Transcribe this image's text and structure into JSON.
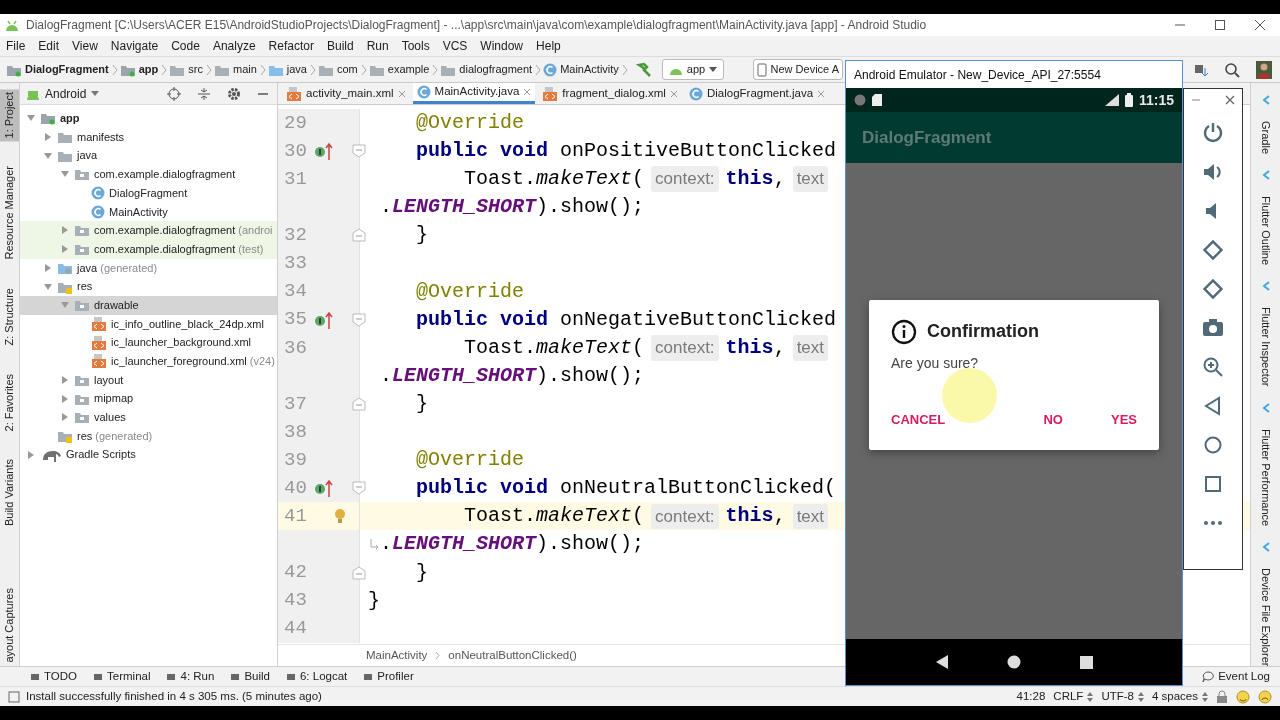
{
  "window": {
    "title": "DialogFragment [C:\\Users\\ACER E15\\AndroidStudioProjects\\DialogFragment] - ...\\app\\src\\main\\java\\com\\example\\dialogfragment\\MainActivity.java [app] - Android Studio"
  },
  "menu": [
    "File",
    "Edit",
    "View",
    "Navigate",
    "Code",
    "Analyze",
    "Refactor",
    "Build",
    "Run",
    "Tools",
    "VCS",
    "Window",
    "Help"
  ],
  "breadcrumb": [
    {
      "label": "DialogFragment",
      "kind": "project"
    },
    {
      "label": "app",
      "kind": "module"
    },
    {
      "label": "src",
      "kind": "folder"
    },
    {
      "label": "main",
      "kind": "folder"
    },
    {
      "label": "java",
      "kind": "source"
    },
    {
      "label": "com",
      "kind": "folder"
    },
    {
      "label": "example",
      "kind": "folder"
    },
    {
      "label": "dialogfragment",
      "kind": "folder"
    },
    {
      "label": "MainActivity",
      "kind": "class"
    }
  ],
  "run_config": "app",
  "device": "New Device A",
  "left_tools": [
    {
      "label": "1: Project",
      "selected": true
    },
    {
      "label": "Resource Manager",
      "selected": false
    },
    {
      "label": "Z: Structure",
      "selected": false
    },
    {
      "label": "2: Favorites",
      "selected": false
    },
    {
      "label": "Build Variants",
      "selected": false
    },
    {
      "label": "ayout Captures",
      "selected": false
    }
  ],
  "right_tools": [
    {
      "label": "Gradle"
    },
    {
      "label": "Flutter Outline"
    },
    {
      "label": "Flutter Inspector"
    },
    {
      "label": "Flutter Performance"
    },
    {
      "label": "Device File Explorer"
    }
  ],
  "project_view": "Android",
  "tree": [
    {
      "label": "app",
      "kind": "module",
      "expanded": true,
      "selected": false,
      "children": [
        {
          "label": "manifests",
          "kind": "folder",
          "expanded": false,
          "selected": false
        },
        {
          "label": "java",
          "kind": "folder",
          "expanded": true,
          "selected": false,
          "children": [
            {
              "label": "com.example.dialogfragment",
              "kind": "package",
              "expanded": true,
              "selected": false,
              "children": [
                {
                  "label": "DialogFragment",
                  "kind": "class",
                  "selected": false
                },
                {
                  "label": "MainActivity",
                  "kind": "class",
                  "selected": false
                }
              ]
            },
            {
              "label": "com.example.dialogfragment",
              "suffix": "(androi",
              "kind": "package",
              "tinted": true,
              "expanded": false,
              "selected": false
            },
            {
              "label": "com.example.dialogfragment",
              "suffix": "(test)",
              "kind": "package",
              "tinted": true,
              "expanded": false,
              "selected": false
            }
          ]
        },
        {
          "label": "java",
          "suffix": "(generated)",
          "kind": "generated",
          "expanded": false,
          "selected": false
        },
        {
          "label": "res",
          "kind": "res",
          "expanded": true,
          "selected": false,
          "children": [
            {
              "label": "drawable",
              "kind": "package",
              "expanded": true,
              "selected": true,
              "children": [
                {
                  "label": "ic_info_outline_black_24dp.xml",
                  "kind": "xml",
                  "selected": false
                },
                {
                  "label": "ic_launcher_background.xml",
                  "kind": "xml",
                  "selected": false
                },
                {
                  "label": "ic_launcher_foreground.xml",
                  "suffix": "(v24)",
                  "kind": "xml",
                  "selected": false
                }
              ]
            },
            {
              "label": "layout",
              "kind": "package",
              "expanded": false,
              "selected": false
            },
            {
              "label": "mipmap",
              "kind": "package",
              "expanded": false,
              "selected": false
            },
            {
              "label": "values",
              "kind": "package",
              "expanded": false,
              "selected": false
            }
          ]
        },
        {
          "label": "res",
          "suffix": "(generated)",
          "kind": "res",
          "selected": false
        }
      ]
    },
    {
      "label": "Gradle Scripts",
      "kind": "gradle",
      "expanded": false,
      "selected": false
    }
  ],
  "tabs": [
    {
      "label": "activity_main.xml",
      "kind": "xml",
      "selected": false
    },
    {
      "label": "MainActivity.java",
      "kind": "class",
      "selected": true
    },
    {
      "label": "fragment_dialog.xml",
      "kind": "xml",
      "selected": false
    },
    {
      "label": "DialogFragment.java",
      "kind": "class",
      "selected": false
    }
  ],
  "code": [
    {
      "number": "29",
      "tokens": [
        {
          "kind": "annotation",
          "text": "    @Override"
        }
      ]
    },
    {
      "number": "30",
      "override": true,
      "fold_start": true,
      "tokens": [
        {
          "kind": "keyword",
          "text": "    public void"
        },
        {
          "kind": "plain",
          "text": " onPositiveButtonClicked"
        }
      ]
    },
    {
      "number": "31",
      "tokens": [
        {
          "kind": "plain",
          "text": "        Toast."
        },
        {
          "kind": "method",
          "text": "makeText"
        },
        {
          "kind": "plain",
          "text": "("
        },
        {
          "kind": "hint",
          "text": "context:"
        },
        {
          "kind": "keyword",
          "text": "this"
        },
        {
          "kind": "plain",
          "text": ","
        },
        {
          "kind": "hint",
          "text": "text"
        }
      ]
    },
    {
      "tokens": [
        {
          "kind": "plain",
          "text": "."
        },
        {
          "kind": "constant",
          "text": "LENGTH_SHORT"
        },
        {
          "kind": "plain",
          "text": ").show();"
        }
      ]
    },
    {
      "number": "32",
      "fold_end": true,
      "tokens": [
        {
          "kind": "plain",
          "text": "    }"
        }
      ]
    },
    {
      "number": "33"
    },
    {
      "number": "34",
      "tokens": [
        {
          "kind": "annotation",
          "text": "    @Override"
        }
      ]
    },
    {
      "number": "35",
      "override": true,
      "fold_start": true,
      "tokens": [
        {
          "kind": "keyword",
          "text": "    public void"
        },
        {
          "kind": "plain",
          "text": " onNegativeButtonClicked"
        }
      ]
    },
    {
      "number": "36",
      "tokens": [
        {
          "kind": "plain",
          "text": "        Toast."
        },
        {
          "kind": "method",
          "text": "makeText"
        },
        {
          "kind": "plain",
          "text": "("
        },
        {
          "kind": "hint",
          "text": "context:"
        },
        {
          "kind": "keyword",
          "text": "this"
        },
        {
          "kind": "plain",
          "text": ","
        },
        {
          "kind": "hint",
          "text": "text"
        }
      ]
    },
    {
      "tokens": [
        {
          "kind": "plain",
          "text": "."
        },
        {
          "kind": "constant",
          "text": "LENGTH_SHORT"
        },
        {
          "kind": "plain",
          "text": ").show();"
        }
      ]
    },
    {
      "number": "37",
      "fold_end": true,
      "tokens": [
        {
          "kind": "plain",
          "text": "    }"
        }
      ]
    },
    {
      "number": "38"
    },
    {
      "number": "39",
      "tokens": [
        {
          "kind": "annotation",
          "text": "    @Override"
        }
      ]
    },
    {
      "number": "40",
      "override": true,
      "fold_start": true,
      "tokens": [
        {
          "kind": "keyword",
          "text": "    public void"
        },
        {
          "kind": "plain",
          "text": " onNeutralButtonClicked("
        }
      ]
    },
    {
      "number": "41",
      "current": true,
      "bulb": true,
      "tokens": [
        {
          "kind": "plain",
          "text": "        Toast."
        },
        {
          "kind": "method",
          "text": "makeText"
        },
        {
          "kind": "plain",
          "text": "("
        },
        {
          "kind": "hint",
          "text": "context:"
        },
        {
          "kind": "keyword",
          "text": "this"
        },
        {
          "kind": "plain",
          "text": ","
        },
        {
          "kind": "hint",
          "text": "text"
        }
      ]
    },
    {
      "wrap_marker": true,
      "tokens": [
        {
          "kind": "plain",
          "text": "."
        },
        {
          "kind": "constant",
          "text": "LENGTH_SHORT"
        },
        {
          "kind": "plain",
          "text": ").show();"
        }
      ]
    },
    {
      "number": "42",
      "fold_end": true,
      "tokens": [
        {
          "kind": "plain",
          "text": "    }"
        }
      ]
    },
    {
      "number": "43",
      "tokens": [
        {
          "kind": "plain",
          "text": "}"
        }
      ]
    },
    {
      "number": "44"
    }
  ],
  "editor_breadcrumb": [
    "MainActivity",
    "onNeutralButtonClicked()"
  ],
  "bottom_tools": [
    "TODO",
    "Terminal",
    "4: Run",
    "Build",
    "6: Logcat",
    "Profiler"
  ],
  "event_log": "Event Log",
  "status": {
    "message": "Install successfully finished in 4 s 305 ms. (5 minutes ago)",
    "position": "41:28",
    "line_separator": "CRLF",
    "encoding": "UTF-8",
    "indent": "4 spaces"
  },
  "emulator": {
    "title": "Android Emulator - New_Device_API_27:5554",
    "time": "11:15",
    "app_title": "DialogFragment",
    "dialog": {
      "title": "Confirmation",
      "message": "Are you sure?",
      "buttons": [
        "CANCEL",
        "NO",
        "YES"
      ]
    }
  }
}
